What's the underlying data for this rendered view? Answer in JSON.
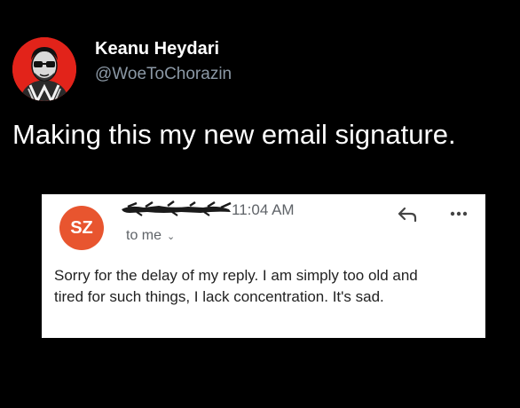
{
  "tweet": {
    "author_name": "Keanu Heydari",
    "author_handle": "@WoeToChorazin",
    "text": "Making this my new email signature."
  },
  "email": {
    "sender_initials": "SZ",
    "time": "11:04 AM",
    "recipient_label": "to me",
    "body_line_1": "Sorry for the delay of my reply. I am simply too old and",
    "body_line_2": "tired for such things, I lack concentration. It's sad.",
    "icons": {
      "reply": "reply-icon",
      "more": "more-options-icon",
      "recipient_details": "chevron-down-icon"
    }
  },
  "colors": {
    "background": "#000000",
    "avatar_bg": "#e2231a",
    "sender_avatar_bg": "#e8552f",
    "handle": "#8b98a5",
    "meta_text": "#5f6368"
  }
}
